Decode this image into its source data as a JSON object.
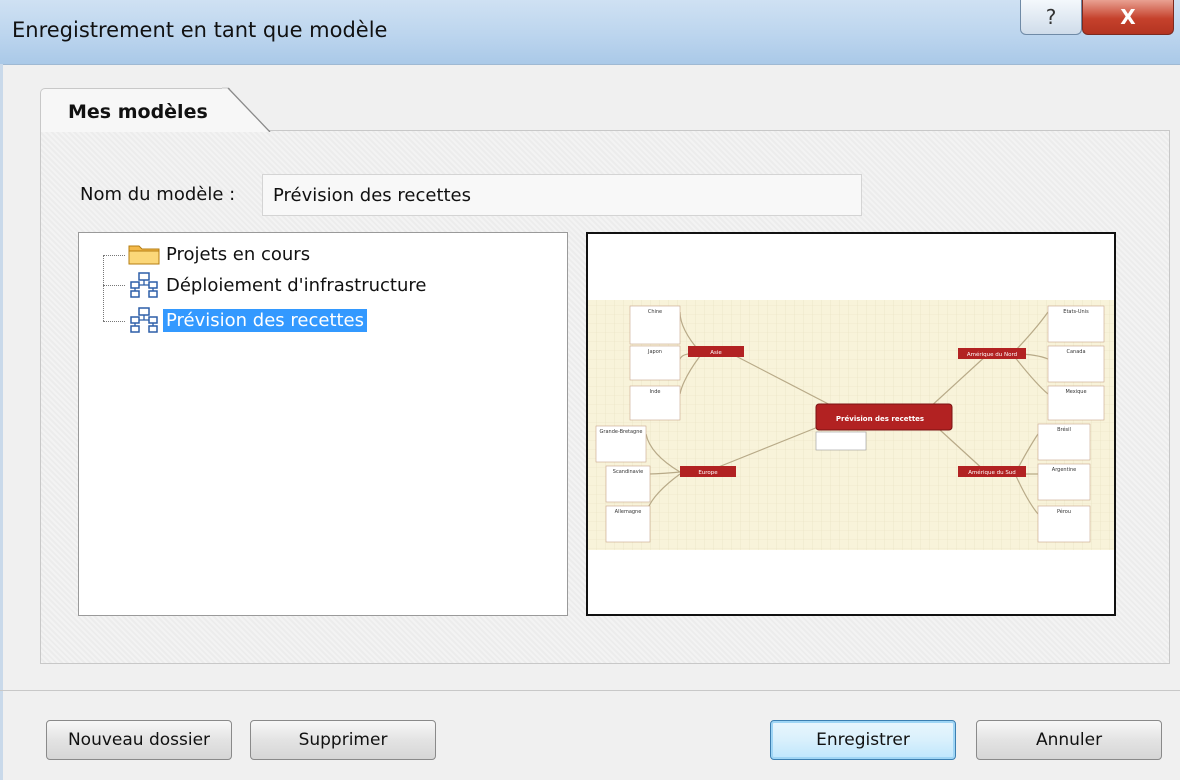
{
  "window": {
    "title": "Enregistrement en tant que modèle",
    "help_glyph": "?",
    "close_glyph": "X"
  },
  "tabs": [
    {
      "label": "Mes modèles",
      "active": true
    }
  ],
  "form": {
    "name_label": "Nom du modèle :",
    "name_value": "Prévision des recettes"
  },
  "tree": {
    "items": [
      {
        "label": "Projets en cours",
        "icon": "folder-icon",
        "selected": false
      },
      {
        "label": "Déploiement d'infrastructure",
        "icon": "template-icon",
        "selected": false
      },
      {
        "label": "Prévision des recettes",
        "icon": "template-icon",
        "selected": true
      }
    ]
  },
  "preview": {
    "center": "Prévision des recettes",
    "branches": [
      "Asie",
      "Europe",
      "Amérique du Nord",
      "Amérique du Sud"
    ],
    "leaves": [
      "Chine",
      "Japon",
      "Inde",
      "Grande-Bretagne",
      "Scandinavie",
      "Allemagne",
      "Etats-Unis",
      "Canada",
      "Mexique",
      "Brésil",
      "Argentine",
      "Pérou"
    ]
  },
  "buttons": {
    "new_folder": "Nouveau dossier",
    "delete": "Supprimer",
    "save": "Enregistrer",
    "cancel": "Annuler"
  },
  "colors": {
    "selection": "#3399ff",
    "topic_red": "#b22222",
    "preview_bg": "#f8f3da"
  }
}
